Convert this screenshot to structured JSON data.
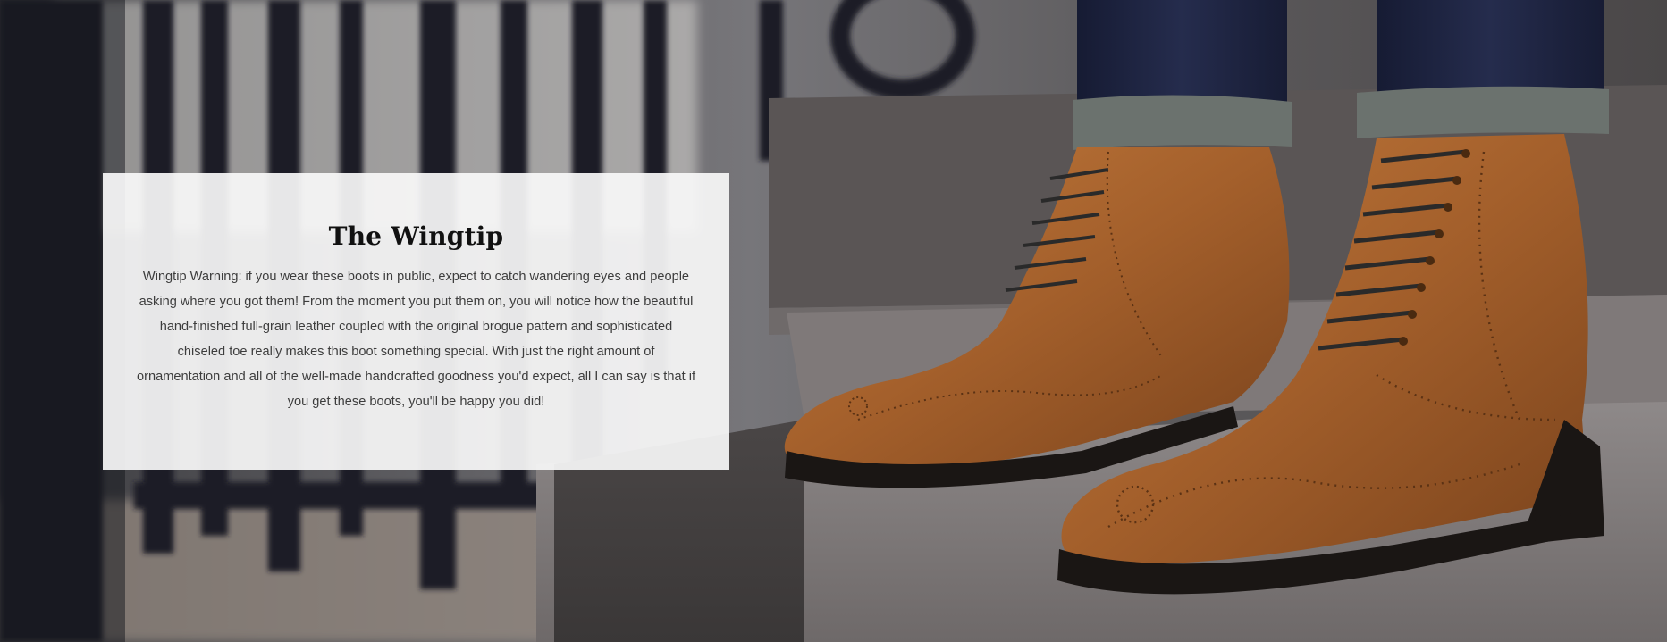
{
  "hero": {
    "image_subject": "brown leather wingtip brogue boots with dark laces on stone steps beside black iron railing",
    "colors": {
      "boot_leather": "#a35f2b",
      "stone_step": "#7b7575",
      "denim": "#1e2542",
      "railing": "#1c1f26",
      "card_background": "#f8f8f8"
    }
  },
  "card": {
    "title": "The Wingtip",
    "body": "Wingtip Warning: if you wear these boots in public, expect to catch wandering eyes and people asking where you got them! From the moment you put them on, you will notice how the beautiful hand-finished full-grain leather coupled with the original brogue pattern and sophisticated chiseled toe really makes this boot something special. With just the right amount of ornamentation and all of the well-made handcrafted goodness you'd expect, all I can say is that if you get these boots, you'll be happy you did!"
  }
}
